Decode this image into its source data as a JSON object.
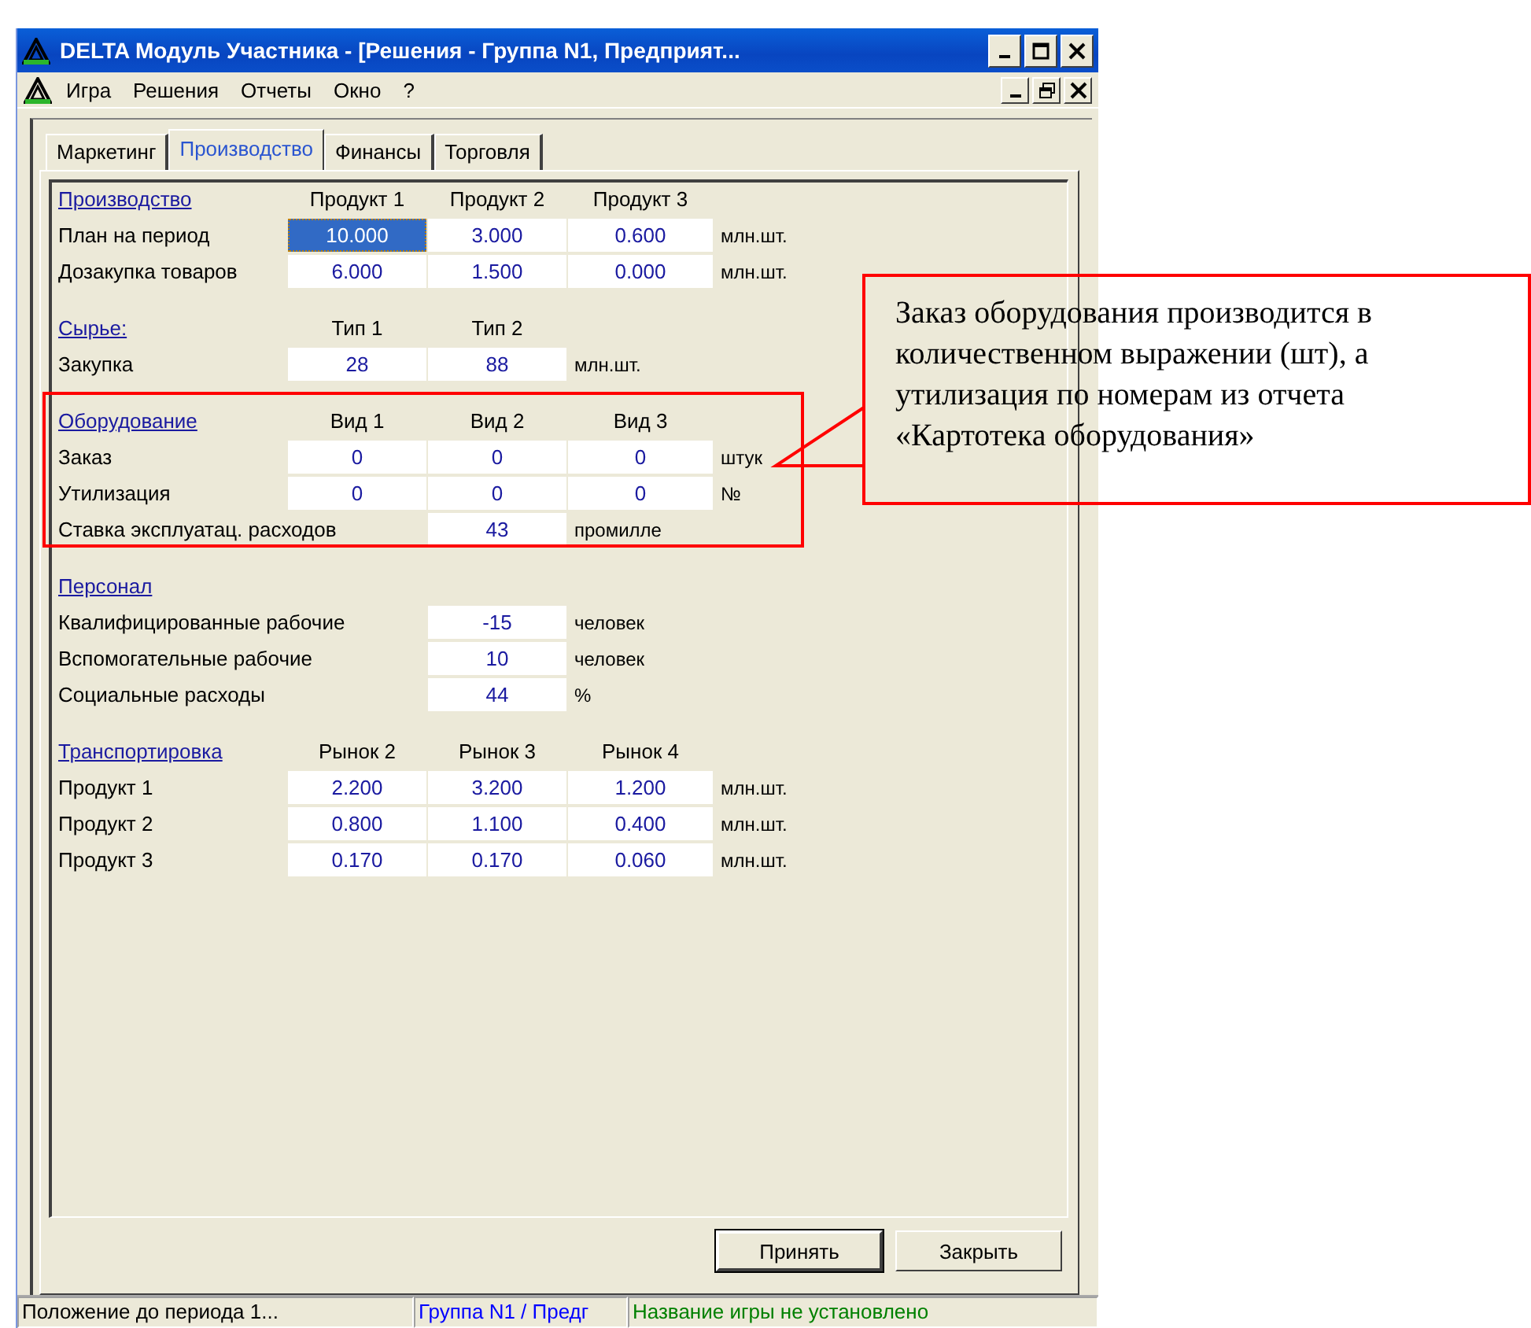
{
  "window": {
    "title": "DELTA Модуль Участника - [Решения - Группа N1, Предприят..."
  },
  "menu": [
    "Игра",
    "Решения",
    "Отчеты",
    "Окно",
    "?"
  ],
  "tabs": [
    {
      "label": "Маркетинг",
      "selected": false
    },
    {
      "label": "Производство",
      "selected": true
    },
    {
      "label": "Финансы",
      "selected": false
    },
    {
      "label": "Торговля",
      "selected": false
    }
  ],
  "sections": [
    {
      "heading": "Производство",
      "columns": [
        "Продукт 1",
        "Продукт 2",
        "Продукт 3"
      ],
      "rows": [
        {
          "label": "План на период",
          "cells": [
            {
              "text": "10.000",
              "selected": true
            },
            {
              "text": "3.000",
              "selected": false
            },
            {
              "text": "0.600",
              "selected": false
            }
          ],
          "unit": "млн.шт."
        },
        {
          "label": "Дозакупка товаров",
          "cells": [
            {
              "text": "6.000",
              "selected": false
            },
            {
              "text": "1.500",
              "selected": false
            },
            {
              "text": "0.000",
              "selected": false
            }
          ],
          "unit": "млн.шт."
        }
      ]
    },
    {
      "heading": "Сырье:",
      "columns": [
        "Тип 1",
        "Тип 2"
      ],
      "rows": [
        {
          "label": "Закупка",
          "cells": [
            {
              "text": "28",
              "selected": false
            },
            {
              "text": "88",
              "selected": false
            }
          ],
          "unit": "млн.шт."
        }
      ]
    },
    {
      "heading": "Оборудование",
      "columns": [
        "Вид 1",
        "Вид 2",
        "Вид 3"
      ],
      "rows": [
        {
          "label": "Заказ",
          "cells": [
            {
              "text": "0",
              "selected": false
            },
            {
              "text": "0",
              "selected": false
            },
            {
              "text": "0",
              "selected": false
            }
          ],
          "unit": "штук"
        },
        {
          "label": "Утилизация",
          "cells": [
            {
              "text": "0",
              "selected": false
            },
            {
              "text": "0",
              "selected": false
            },
            {
              "text": "0",
              "selected": false
            }
          ],
          "unit": "№"
        },
        {
          "label": "Ставка эксплуатац. расходов",
          "cells": [
            null,
            {
              "text": "43",
              "selected": false
            }
          ],
          "unit": "промилле"
        }
      ]
    },
    {
      "heading": "Персонал",
      "rows": [
        {
          "label": "Квалифицированные рабочие",
          "cells": [
            null,
            {
              "text": "-15",
              "selected": false
            }
          ],
          "unit": "человек"
        },
        {
          "label": "Вспомогательные рабочие",
          "cells": [
            null,
            {
              "text": "10",
              "selected": false
            }
          ],
          "unit": "человек"
        },
        {
          "label": "Социальные расходы",
          "cells": [
            null,
            {
              "text": "44",
              "selected": false
            }
          ],
          "unit": "%"
        }
      ]
    },
    {
      "heading": "Транспортировка",
      "columns": [
        "Рынок 2",
        "Рынок 3",
        "Рынок 4"
      ],
      "rows": [
        {
          "label": "Продукт 1",
          "cells": [
            {
              "text": "2.200",
              "selected": false
            },
            {
              "text": "3.200",
              "selected": false
            },
            {
              "text": "1.200",
              "selected": false
            }
          ],
          "unit": "млн.шт."
        },
        {
          "label": "Продукт 2",
          "cells": [
            {
              "text": "0.800",
              "selected": false
            },
            {
              "text": "1.100",
              "selected": false
            },
            {
              "text": "0.400",
              "selected": false
            }
          ],
          "unit": "млн.шт."
        },
        {
          "label": "Продукт 3",
          "cells": [
            {
              "text": "0.170",
              "selected": false
            },
            {
              "text": "0.170",
              "selected": false
            },
            {
              "text": "0.060",
              "selected": false
            }
          ],
          "unit": "млн.шт."
        }
      ]
    }
  ],
  "buttons": [
    {
      "label": "Принять",
      "default": true
    },
    {
      "label": "Закрыть",
      "default": false
    }
  ],
  "status_bar": [
    {
      "text": "Положение до периода 1...",
      "color": "#000000"
    },
    {
      "text": "Группа N1 / Предг",
      "color": "#0000ff"
    },
    {
      "text": "Название игры не установлено",
      "color": "#008000"
    }
  ],
  "annotation": {
    "text": "Заказ оборудования производится в количественном выражении (шт), а утилизация по номерам из отчета «Картотека оборудования»"
  }
}
